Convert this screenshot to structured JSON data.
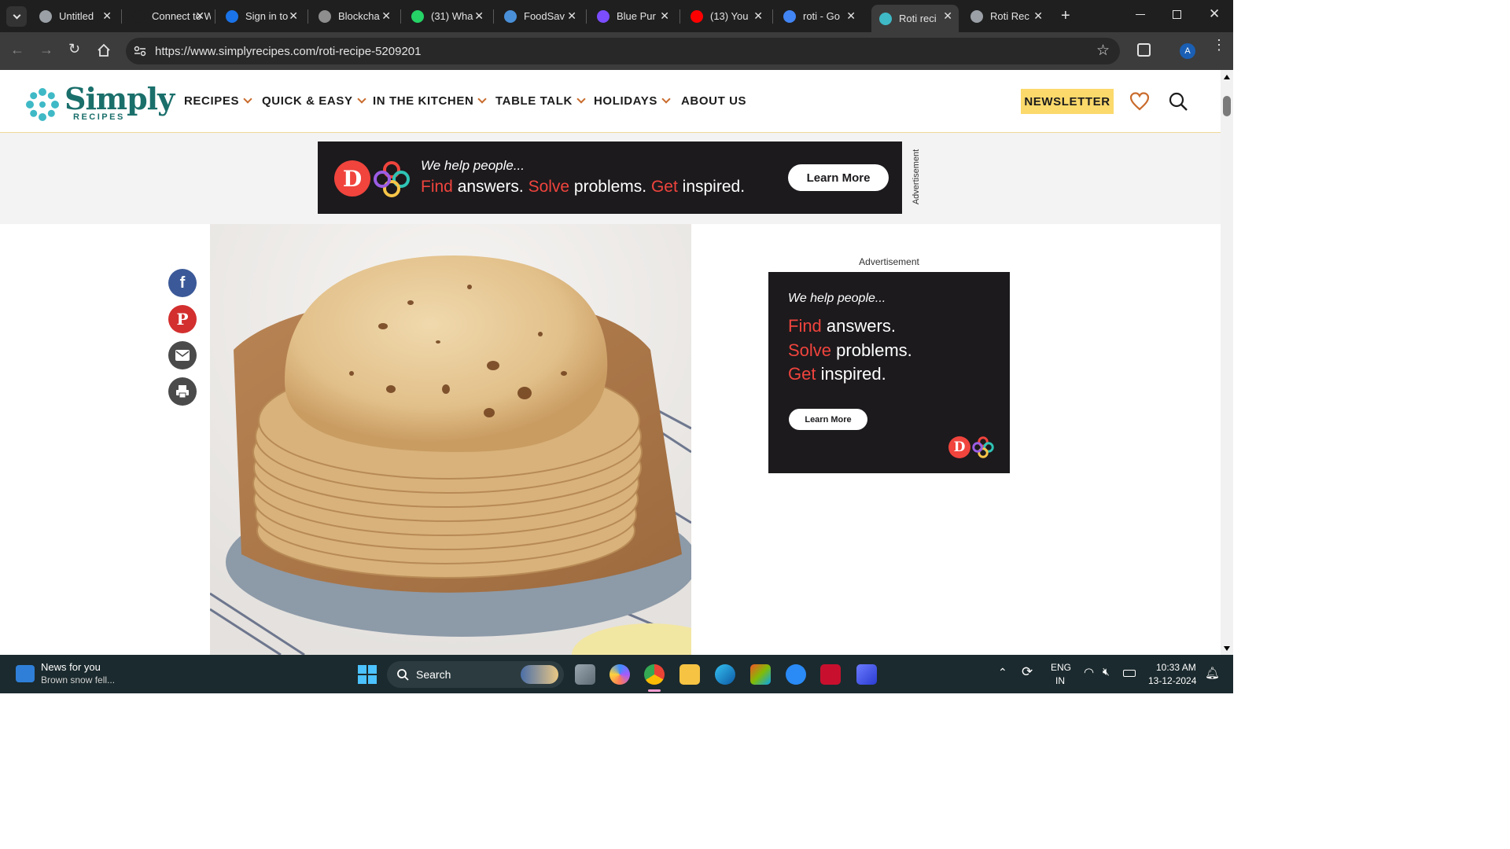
{
  "browser": {
    "tabs": [
      {
        "title": "Untitled",
        "favicon": "globe-icon",
        "color": "#9aa0a6"
      },
      {
        "title": "Connect to W",
        "favicon": "none",
        "color": "#1f1f1f"
      },
      {
        "title": "Sign in to",
        "favicon": "s-logo-icon",
        "color": "#1a73e8"
      },
      {
        "title": "Blockcha",
        "favicon": "openai-icon",
        "color": "#8e8e8e"
      },
      {
        "title": "(31) Wha",
        "favicon": "whatsapp-icon",
        "color": "#25d366"
      },
      {
        "title": "FoodSav",
        "favicon": "foodsaver-icon",
        "color": "#4a90d9"
      },
      {
        "title": "Blue Pur",
        "favicon": "app-icon",
        "color": "#7b4dff"
      },
      {
        "title": "(13) You",
        "favicon": "youtube-icon",
        "color": "#ff0000"
      },
      {
        "title": "roti - Go",
        "favicon": "google-icon",
        "color": "#4285f4"
      },
      {
        "title": "Roti reci",
        "favicon": "simplyrecipes-icon",
        "color": "#3fb9c6"
      },
      {
        "title": "Roti Rec",
        "favicon": "recipe-icon",
        "color": "#9aa0a6"
      }
    ],
    "url": "https://www.simplyrecipes.com/roti-recipe-5209201",
    "profile_initial": "A"
  },
  "site": {
    "logo_main": "Simply",
    "logo_sub": "RECIPES",
    "nav": [
      {
        "label": "RECIPES",
        "has_dropdown": true
      },
      {
        "label": "QUICK & EASY",
        "has_dropdown": true
      },
      {
        "label": "IN THE KITCHEN",
        "has_dropdown": true
      },
      {
        "label": "TABLE TALK",
        "has_dropdown": true
      },
      {
        "label": "HOLIDAYS",
        "has_dropdown": true
      },
      {
        "label": "ABOUT US",
        "has_dropdown": false
      }
    ],
    "newsletter_label": "NEWSLETTER",
    "accent": "#c96b2c",
    "newsletter_bg": "#fbd96b"
  },
  "top_ad": {
    "line1": "We help people...",
    "find": "Find",
    "answers": " answers. ",
    "solve": "Solve",
    "problems": " problems. ",
    "get": "Get",
    "inspired": " inspired.",
    "button": "Learn More",
    "vertical_label": "Advertisement"
  },
  "side_ad": {
    "label": "Advertisement",
    "line1": "We help people...",
    "find": "Find",
    "answers": " answers.",
    "solve": "Solve",
    "problems": " problems.",
    "get": "Get",
    "inspired": " inspired.",
    "button": "Learn More"
  },
  "share": [
    "facebook-icon",
    "pinterest-icon",
    "email-icon",
    "print-icon"
  ],
  "taskbar": {
    "news_title": "News for you",
    "news_sub": "Brown snow fell...",
    "search_placeholder": "Search",
    "lang1": "ENG",
    "lang2": "IN",
    "time": "10:33 AM",
    "date": "13-12-2024"
  }
}
